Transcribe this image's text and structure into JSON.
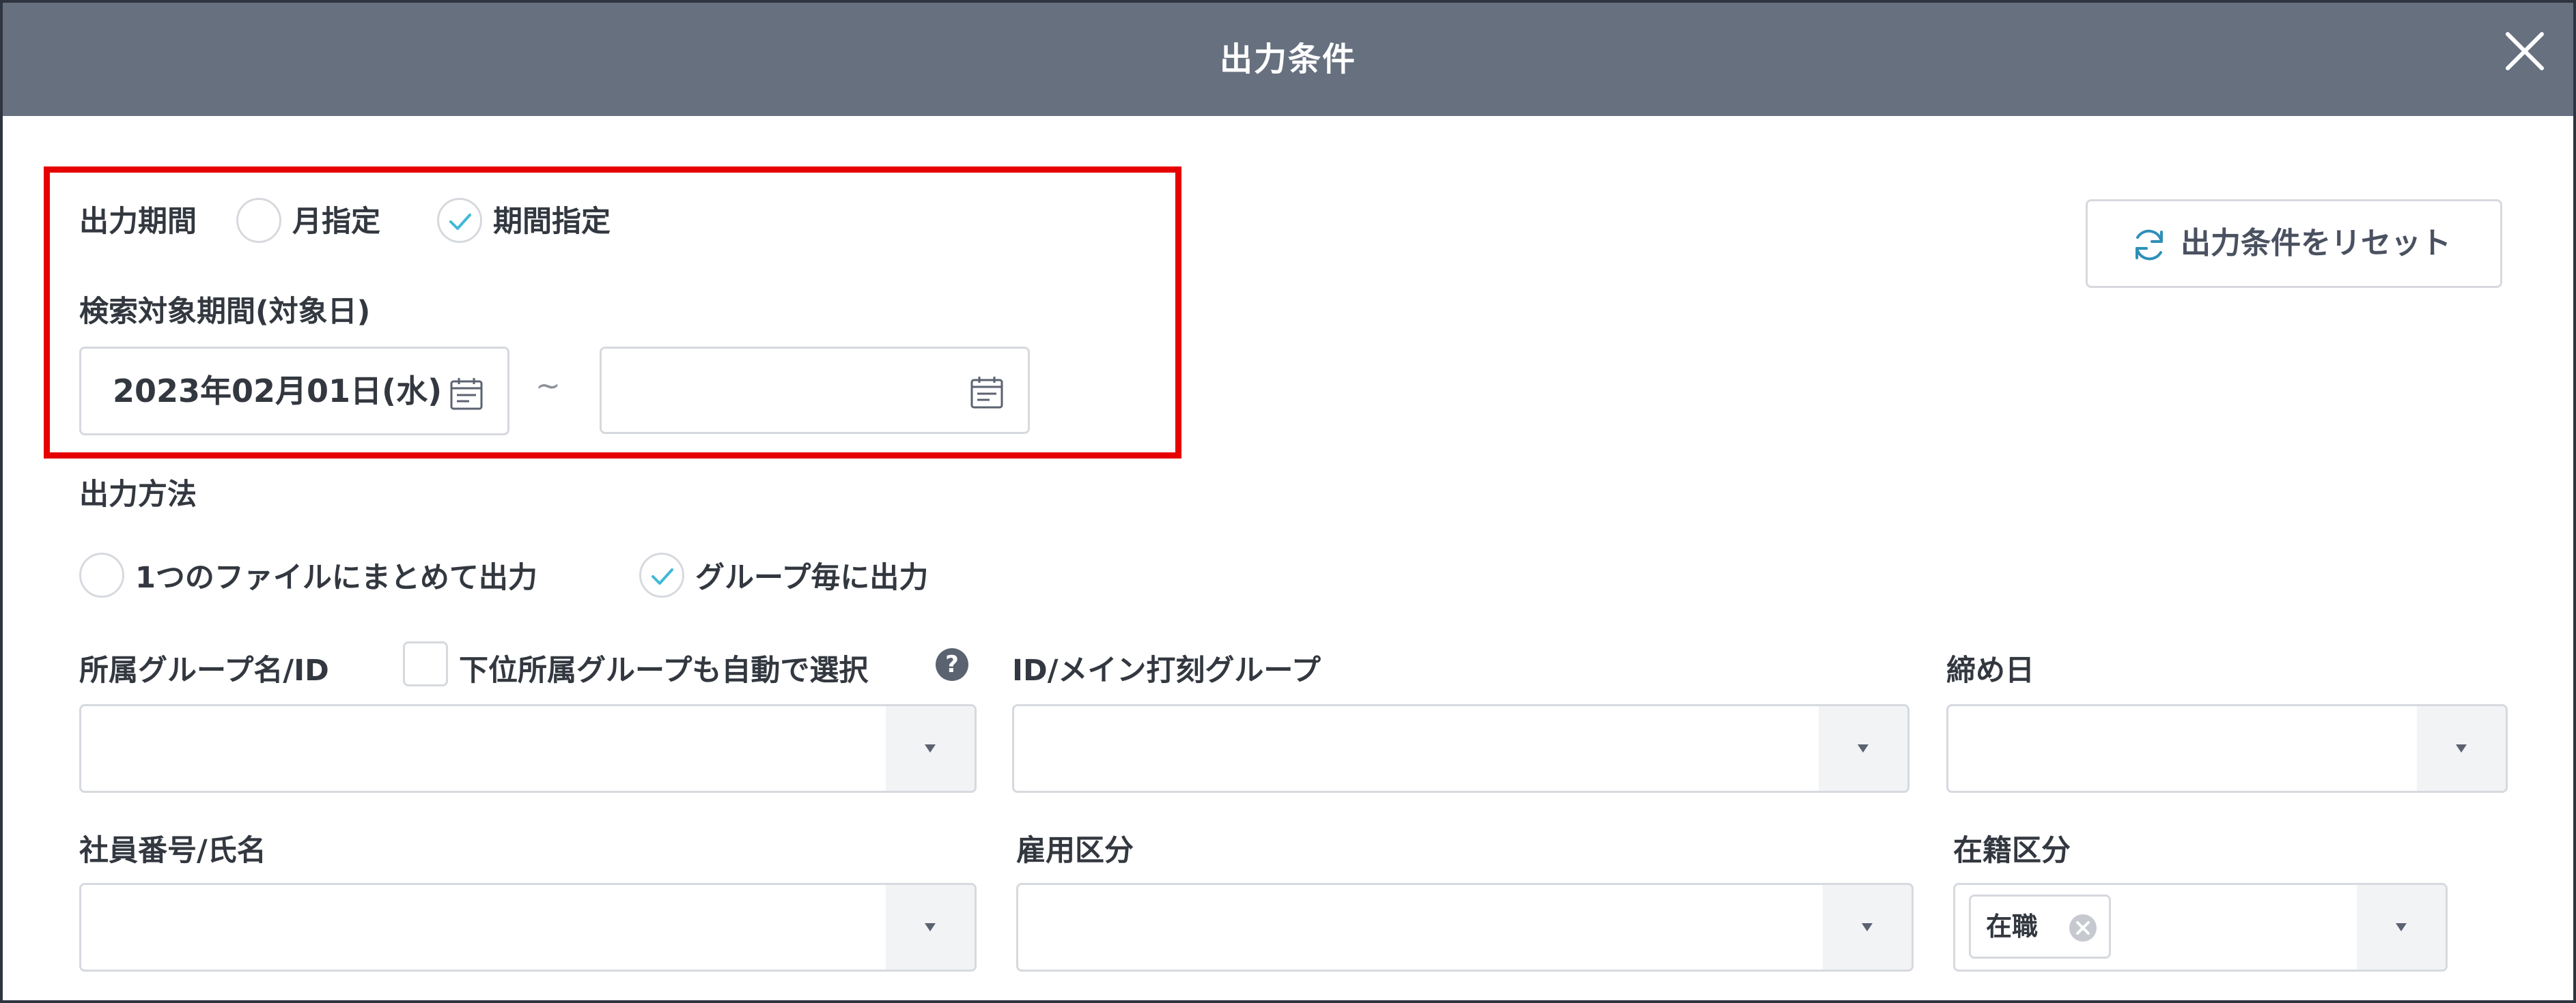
{
  "dialog": {
    "title": "出力条件"
  },
  "output_period": {
    "label": "出力期間",
    "options": [
      {
        "label": "月指定",
        "selected": false
      },
      {
        "label": "期間指定",
        "selected": true
      }
    ]
  },
  "search_period": {
    "label": "検索対象期間(対象日)",
    "start_date": "2023年02月01日(水)",
    "end_date": "",
    "separator": "~"
  },
  "reset_button": {
    "label": "出力条件をリセット"
  },
  "output_method": {
    "label": "出力方法",
    "options": [
      {
        "label": "1つのファイルにまとめて出力",
        "selected": false
      },
      {
        "label": "グループ毎に出力",
        "selected": true
      }
    ]
  },
  "group_filter": {
    "label": "所属グループ名/ID",
    "auto_select_label": "下位所属グループも自動で選択",
    "auto_select_checked": false,
    "help": "?"
  },
  "main_clock_group": {
    "label": "ID/メイン打刻グループ"
  },
  "closing_day": {
    "label": "締め日"
  },
  "employee": {
    "label": "社員番号/氏名"
  },
  "employment_type": {
    "label": "雇用区分"
  },
  "enrollment": {
    "label": "在籍区分",
    "tags": [
      "在職"
    ]
  },
  "colors": {
    "header": "#66707f",
    "highlight": "#e60000",
    "check": "#3fb9d6"
  }
}
